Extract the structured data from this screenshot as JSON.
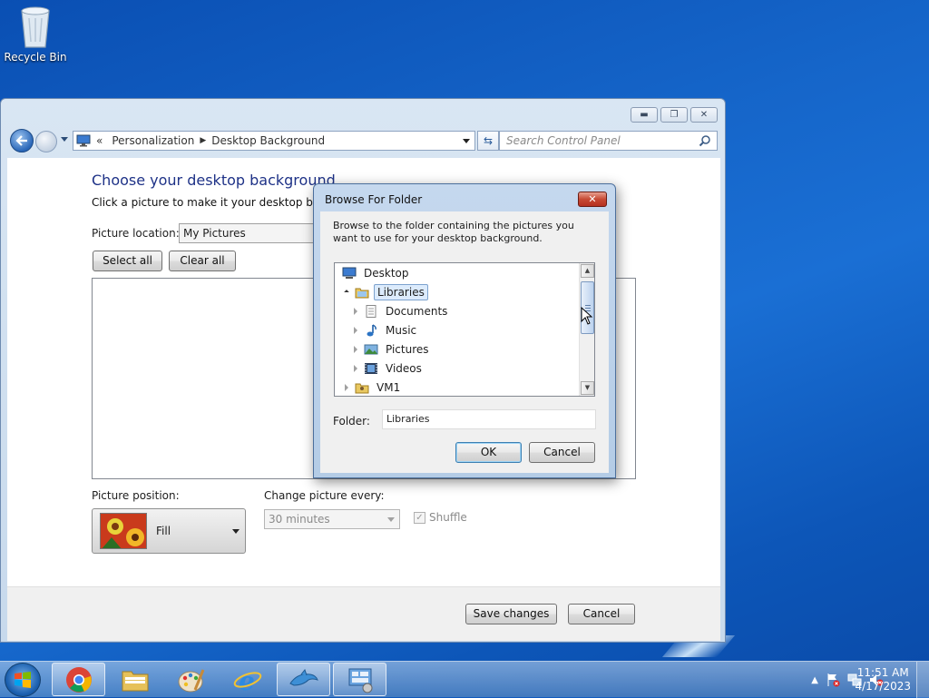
{
  "desktop": {
    "recycle_bin_label": "Recycle Bin"
  },
  "control_panel": {
    "breadcrumb_prefix": "«",
    "breadcrumb": [
      "Personalization",
      "Desktop Background"
    ],
    "search_placeholder": "Search Control Panel",
    "heading": "Choose your desktop background",
    "subheading": "Click a picture to make it your desktop backgro",
    "picture_location_label": "Picture location:",
    "picture_location_value": "My Pictures",
    "select_all_label": "Select all",
    "clear_all_label": "Clear all",
    "picture_position_label": "Picture position:",
    "picture_position_value": "Fill",
    "change_picture_label": "Change picture every:",
    "change_picture_value": "30 minutes",
    "shuffle_label": "Shuffle",
    "shuffle_checked": true,
    "save_label": "Save changes",
    "cancel_label": "Cancel"
  },
  "dialog": {
    "title": "Browse For Folder",
    "description": "Browse to the folder containing the pictures you want to use for your desktop background.",
    "tree": [
      {
        "label": "Desktop",
        "icon": "desktop-icon",
        "expander": "none",
        "selected": false
      },
      {
        "label": "Libraries",
        "icon": "libraries-icon",
        "expander": "open",
        "selected": true
      },
      {
        "label": "Documents",
        "icon": "documents-icon",
        "expander": "closed",
        "selected": false
      },
      {
        "label": "Music",
        "icon": "music-icon",
        "expander": "closed",
        "selected": false
      },
      {
        "label": "Pictures",
        "icon": "pictures-icon",
        "expander": "closed",
        "selected": false
      },
      {
        "label": "Videos",
        "icon": "videos-icon",
        "expander": "closed",
        "selected": false
      },
      {
        "label": "VM1",
        "icon": "user-folder-icon",
        "expander": "closed",
        "selected": false
      }
    ],
    "folder_label": "Folder:",
    "folder_value": "Libraries",
    "ok_label": "OK",
    "cancel_label": "Cancel"
  },
  "taskbar": {
    "apps": [
      {
        "name": "chrome",
        "open": true
      },
      {
        "name": "file-explorer",
        "open": false
      },
      {
        "name": "paint",
        "open": false
      },
      {
        "name": "internet-explorer",
        "open": false
      },
      {
        "name": "dolphin-emulator",
        "open": true
      },
      {
        "name": "control-panel",
        "open": true
      }
    ],
    "time": "11:51 AM",
    "date": "4/17/2023"
  }
}
